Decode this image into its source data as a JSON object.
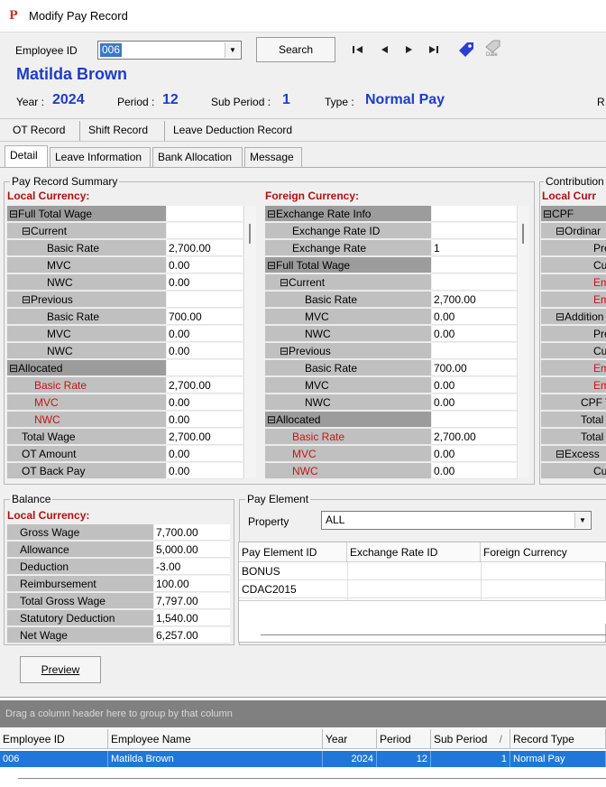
{
  "window": {
    "title": "Modify Pay Record",
    "logo": "P"
  },
  "header": {
    "employee_id_label": "Employee ID",
    "employee_id_value": "006",
    "search_label": "Search",
    "employee_name": "Matilda Brown",
    "year_label": "Year :",
    "year_value": "2024",
    "period_label": "Period :",
    "period_value": "12",
    "subperiod_label": "Sub Period :",
    "subperiod_value": "1",
    "type_label": "Type :",
    "type_value": "Normal Pay",
    "cut_label": "R",
    "nav": [
      "first-icon",
      "prev-icon",
      "next-icon",
      "last-icon",
      "tag-icon",
      "date-icon"
    ],
    "date_icon_text": "Date"
  },
  "top_tabs": [
    "OT Record",
    "Shift Record",
    "Leave Deduction Record"
  ],
  "detail_tabs": [
    "Detail",
    "Leave Information",
    "Bank Allocation",
    "Message"
  ],
  "summary": {
    "group_title": "Pay Record Summary",
    "local_header": "Local Currency:",
    "foreign_header": "Foreign Currency:",
    "local_rows": [
      {
        "label": "⊟Full Total Wage",
        "value": "",
        "indent": 0,
        "style": "dark"
      },
      {
        "label": "⊟Current",
        "value": "",
        "indent": 1,
        "style": "normal"
      },
      {
        "label": "Basic Rate",
        "value": "2,700.00",
        "indent": 3,
        "style": "normal"
      },
      {
        "label": "MVC",
        "value": "0.00",
        "indent": 3,
        "style": "normal"
      },
      {
        "label": "NWC",
        "value": "0.00",
        "indent": 3,
        "style": "normal"
      },
      {
        "label": "⊟Previous",
        "value": "",
        "indent": 1,
        "style": "normal"
      },
      {
        "label": "Basic Rate",
        "value": "700.00",
        "indent": 3,
        "style": "normal"
      },
      {
        "label": "MVC",
        "value": "0.00",
        "indent": 3,
        "style": "normal"
      },
      {
        "label": "NWC",
        "value": "0.00",
        "indent": 3,
        "style": "normal"
      },
      {
        "label": "⊟Allocated",
        "value": "",
        "indent": 0,
        "style": "dark"
      },
      {
        "label": "Basic Rate",
        "value": "2,700.00",
        "indent": 2,
        "style": "red"
      },
      {
        "label": "MVC",
        "value": "0.00",
        "indent": 2,
        "style": "red"
      },
      {
        "label": "NWC",
        "value": "0.00",
        "indent": 2,
        "style": "red"
      },
      {
        "label": "Total Wage",
        "value": "2,700.00",
        "indent": 1,
        "style": "normal"
      },
      {
        "label": "OT Amount",
        "value": "0.00",
        "indent": 1,
        "style": "normal"
      },
      {
        "label": "OT Back Pay",
        "value": "0.00",
        "indent": 1,
        "style": "normal"
      }
    ],
    "foreign_rows": [
      {
        "label": "⊟Exchange Rate Info",
        "value": "",
        "indent": 0,
        "style": "dark"
      },
      {
        "label": "Exchange Rate ID",
        "value": "",
        "indent": 2,
        "style": "normal"
      },
      {
        "label": "Exchange Rate",
        "value": "1",
        "indent": 2,
        "style": "normal"
      },
      {
        "label": "⊟Full Total Wage",
        "value": "",
        "indent": 0,
        "style": "dark"
      },
      {
        "label": "⊟Current",
        "value": "",
        "indent": 1,
        "style": "normal"
      },
      {
        "label": "Basic Rate",
        "value": "2,700.00",
        "indent": 3,
        "style": "normal"
      },
      {
        "label": "MVC",
        "value": "0.00",
        "indent": 3,
        "style": "normal"
      },
      {
        "label": "NWC",
        "value": "0.00",
        "indent": 3,
        "style": "normal"
      },
      {
        "label": "⊟Previous",
        "value": "",
        "indent": 1,
        "style": "normal"
      },
      {
        "label": "Basic Rate",
        "value": "700.00",
        "indent": 3,
        "style": "normal"
      },
      {
        "label": "MVC",
        "value": "0.00",
        "indent": 3,
        "style": "normal"
      },
      {
        "label": "NWC",
        "value": "0.00",
        "indent": 3,
        "style": "normal"
      },
      {
        "label": "⊟Allocated",
        "value": "",
        "indent": 0,
        "style": "dark"
      },
      {
        "label": "Basic Rate",
        "value": "2,700.00",
        "indent": 2,
        "style": "red"
      },
      {
        "label": "MVC",
        "value": "0.00",
        "indent": 2,
        "style": "red"
      },
      {
        "label": "NWC",
        "value": "0.00",
        "indent": 2,
        "style": "red"
      }
    ]
  },
  "contribution": {
    "group_title": "Contribution",
    "local_header": "Local Curr",
    "rows": [
      {
        "label": "⊟CPF",
        "style": "dark",
        "indent": 0
      },
      {
        "label": "⊟Ordinar",
        "style": "normal",
        "indent": 1
      },
      {
        "label": "Prev",
        "style": "normal",
        "indent": 4
      },
      {
        "label": "Curre",
        "style": "normal",
        "indent": 4
      },
      {
        "label": "Empl",
        "style": "red",
        "indent": 4
      },
      {
        "label": "Empl",
        "style": "red",
        "indent": 4
      },
      {
        "label": "⊟Addition",
        "style": "normal",
        "indent": 1
      },
      {
        "label": "Prev",
        "style": "normal",
        "indent": 4
      },
      {
        "label": "Curre",
        "style": "normal",
        "indent": 4
      },
      {
        "label": "Empl",
        "style": "red",
        "indent": 4
      },
      {
        "label": "Empl",
        "style": "red",
        "indent": 4
      },
      {
        "label": "CPF W",
        "style": "normal",
        "indent": 3
      },
      {
        "label": "Total E",
        "style": "normal",
        "indent": 3
      },
      {
        "label": "Total E",
        "style": "normal",
        "indent": 3
      },
      {
        "label": "⊟Excess",
        "style": "normal",
        "indent": 1
      },
      {
        "label": "Curre",
        "style": "normal",
        "indent": 4
      }
    ]
  },
  "balance": {
    "group_title": "Balance",
    "local_header": "Local Currency:",
    "rows": [
      {
        "label": "Gross Wage",
        "value": "7,700.00"
      },
      {
        "label": "Allowance",
        "value": "5,000.00"
      },
      {
        "label": "Deduction",
        "value": "-3.00"
      },
      {
        "label": "Reimbursement",
        "value": "100.00"
      },
      {
        "label": "Total Gross Wage",
        "value": "7,797.00"
      },
      {
        "label": "Statutory Deduction",
        "value": "1,540.00"
      },
      {
        "label": "Net Wage",
        "value": "6,257.00"
      }
    ]
  },
  "pay_element": {
    "group_title": "Pay Element",
    "property_label": "Property",
    "property_value": "ALL",
    "columns": [
      "Pay Element ID",
      "Exchange Rate ID",
      "Foreign Currency"
    ],
    "rows": [
      "BONUS",
      "CDAC2015"
    ]
  },
  "preview_label": "Preview",
  "bottom_grid": {
    "drag_hint": "Drag a column header here to group by that column",
    "columns": [
      "Employee ID",
      "Employee Name",
      "Year",
      "Period",
      "Sub Period",
      "Record Type"
    ],
    "sort_indicator": "/",
    "row": {
      "employee_id": "006",
      "employee_name": "Matilda Brown",
      "year": "2024",
      "period": "12",
      "sub_period": "1",
      "record_type": "Normal Pay"
    }
  },
  "colors": {
    "accent_blue": "#1e3cc8",
    "selection": "#1f78d7",
    "red_label": "#c81414",
    "header_red": "#b01010"
  }
}
